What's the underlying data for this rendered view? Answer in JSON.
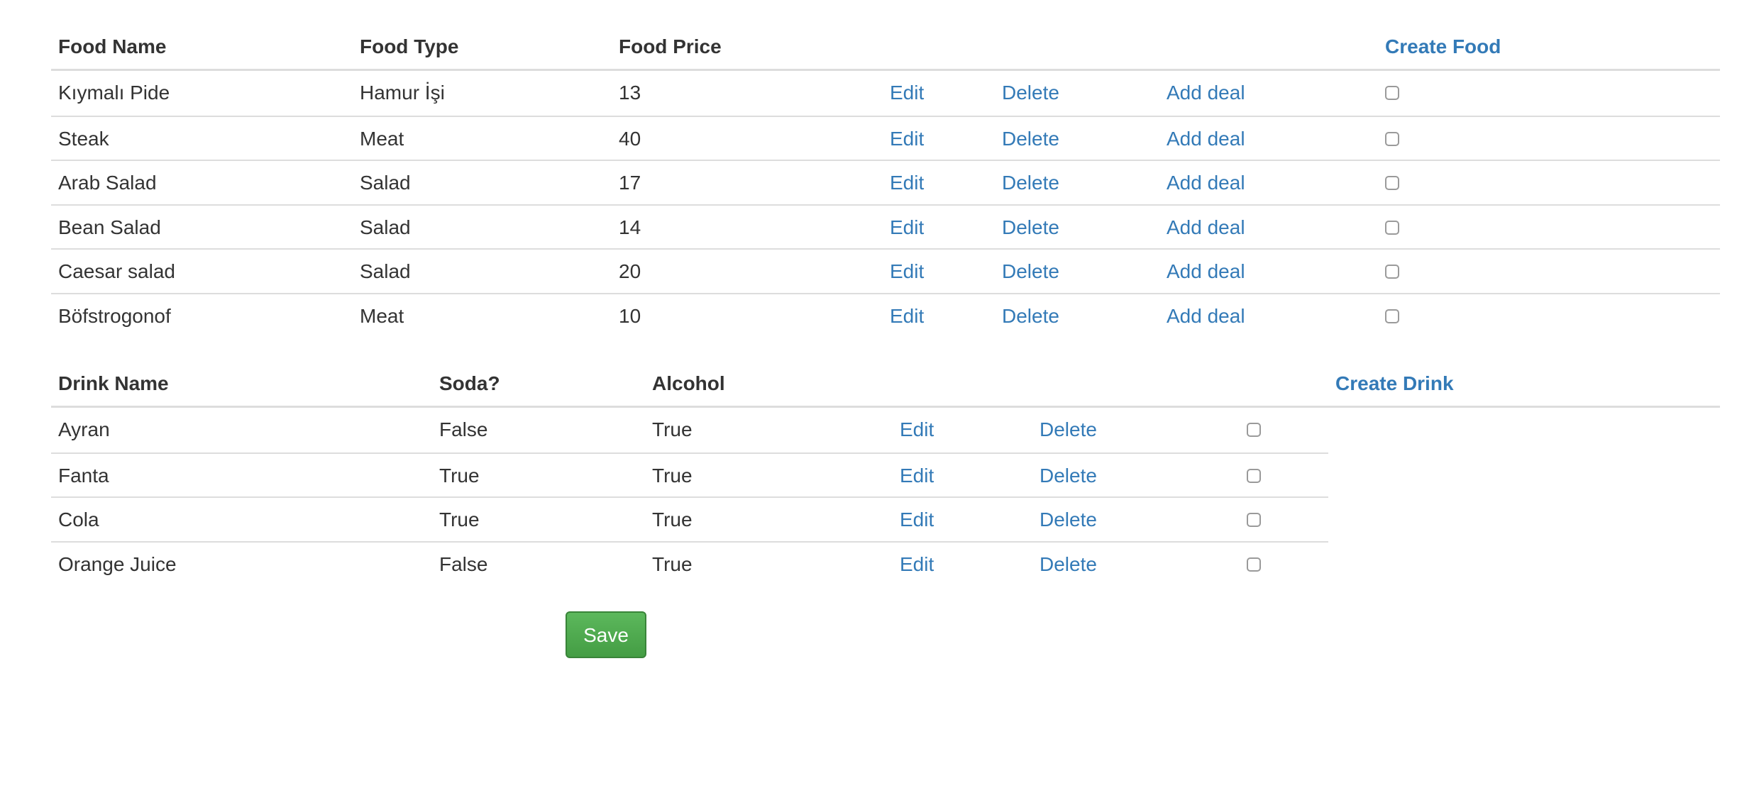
{
  "foods": {
    "headers": {
      "name": "Food Name",
      "type": "Food Type",
      "price": "Food Price",
      "create_link": "Create Food"
    },
    "rows": [
      {
        "name": "Kıymalı Pide",
        "type": "Hamur İşi",
        "price": "13",
        "edit": "Edit",
        "delete": "Delete",
        "add_deal": "Add deal"
      },
      {
        "name": "Steak",
        "type": "Meat",
        "price": "40",
        "edit": "Edit",
        "delete": "Delete",
        "add_deal": "Add deal"
      },
      {
        "name": "Arab Salad",
        "type": "Salad",
        "price": "17",
        "edit": "Edit",
        "delete": "Delete",
        "add_deal": "Add deal"
      },
      {
        "name": "Bean Salad",
        "type": "Salad",
        "price": "14",
        "edit": "Edit",
        "delete": "Delete",
        "add_deal": "Add deal"
      },
      {
        "name": "Caesar salad",
        "type": "Salad",
        "price": "20",
        "edit": "Edit",
        "delete": "Delete",
        "add_deal": "Add deal"
      },
      {
        "name": "Böfstrogonof",
        "type": "Meat",
        "price": "10",
        "edit": "Edit",
        "delete": "Delete",
        "add_deal": "Add deal"
      }
    ]
  },
  "drinks": {
    "headers": {
      "name": "Drink Name",
      "soda": "Soda?",
      "alcohol": "Alcohol",
      "create_link": "Create Drink"
    },
    "rows": [
      {
        "name": "Ayran",
        "soda": "False",
        "alcohol": "True",
        "edit": "Edit",
        "delete": "Delete"
      },
      {
        "name": "Fanta",
        "soda": "True",
        "alcohol": "True",
        "edit": "Edit",
        "delete": "Delete"
      },
      {
        "name": "Cola",
        "soda": "True",
        "alcohol": "True",
        "edit": "Edit",
        "delete": "Delete"
      },
      {
        "name": "Orange Juice",
        "soda": "False",
        "alcohol": "True",
        "edit": "Edit",
        "delete": "Delete"
      }
    ]
  },
  "save_button": {
    "label": "Save",
    "color": "#5cb85c"
  },
  "link_color": "#337ab7"
}
